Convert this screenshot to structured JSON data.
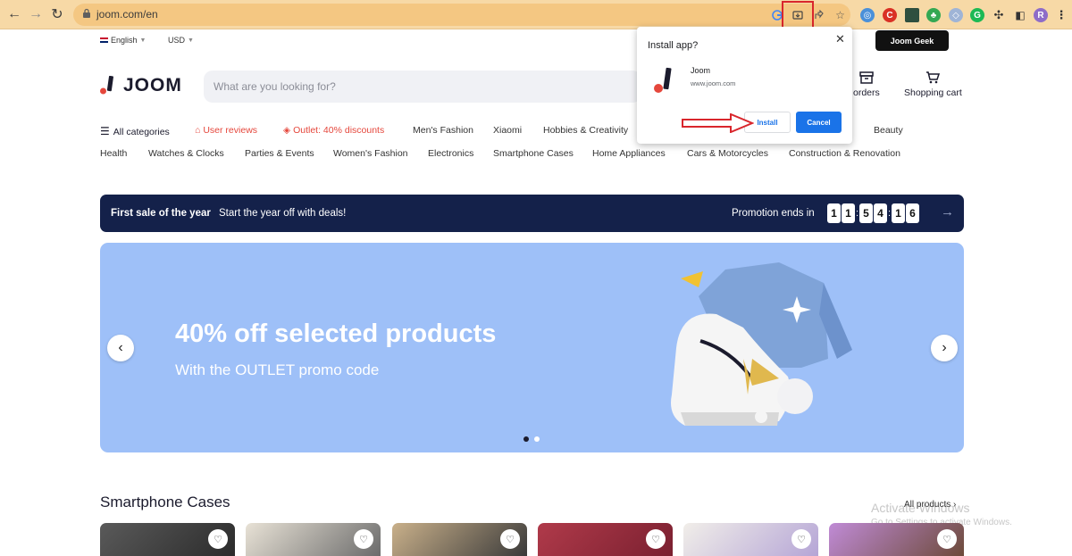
{
  "browser": {
    "url": "joom.com/en"
  },
  "topbar": {
    "language": "English",
    "currency": "USD",
    "geek_button": "Joom Geek"
  },
  "header": {
    "logo_text": "JOOM",
    "search_placeholder": "What are you looking for?",
    "orders_label": "orders",
    "cart_label": "Shopping cart"
  },
  "categories_row1": [
    {
      "label": "All categories"
    },
    {
      "label": "User reviews"
    },
    {
      "label": "Outlet: 40% discounts"
    },
    {
      "label": "Men's Fashion"
    },
    {
      "label": "Xiaomi"
    },
    {
      "label": "Hobbies & Creativity"
    },
    {
      "label": "Beauty"
    }
  ],
  "categories_row2": [
    {
      "label": "Health"
    },
    {
      "label": "Watches & Clocks"
    },
    {
      "label": "Parties & Events"
    },
    {
      "label": "Women's Fashion"
    },
    {
      "label": "Electronics"
    },
    {
      "label": "Smartphone Cases"
    },
    {
      "label": "Home Appliances"
    },
    {
      "label": "Cars & Motorcycles"
    },
    {
      "label": "Construction & Renovation"
    }
  ],
  "promo": {
    "title": "First sale of the year",
    "subtitle": "Start the year off with deals!",
    "ends_label": "Promotion ends in",
    "timer_digits": [
      "1",
      "1",
      "5",
      "4",
      "1",
      "6"
    ]
  },
  "banner": {
    "title": "40% off selected products",
    "subtitle": "With the OUTLET promo code",
    "background": "#9ec0f8"
  },
  "section": {
    "title": "Smartphone Cases",
    "all_products": "All products"
  },
  "install_dialog": {
    "title": "Install app?",
    "app_name": "Joom",
    "app_url": "www.joom.com",
    "install_label": "Install",
    "cancel_label": "Cancel"
  },
  "watermark": {
    "line1": "Activate Windows",
    "line2": "Go to Settings to activate Windows."
  },
  "colors": {
    "accent": "#1a73e8",
    "brand_red": "#e5473c",
    "promo_bg": "#14214a",
    "chrome_bg": "#f7d9a6"
  }
}
